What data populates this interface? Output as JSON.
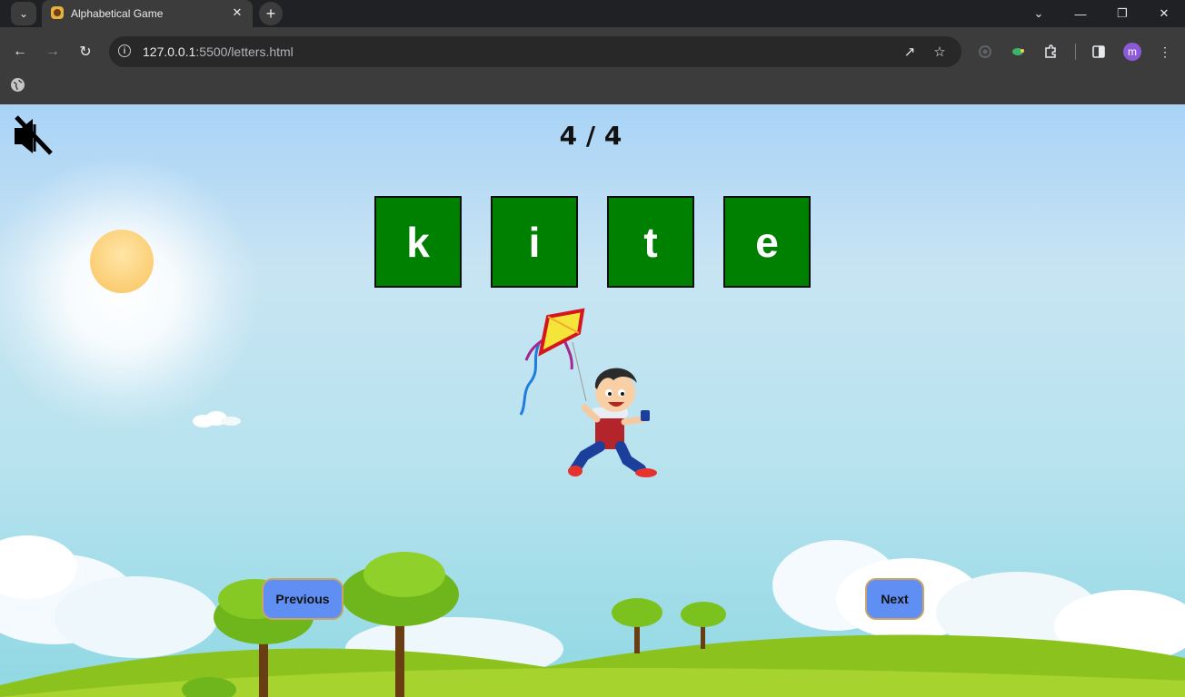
{
  "browser": {
    "tab_title": "Alphabetical Game",
    "url_host": "127.0.0.1",
    "url_rest": ":5500/letters.html",
    "avatar_letter": "m",
    "icons": [
      "tab-search-icon",
      "close-icon",
      "plus-icon",
      "chevron-down-icon",
      "minimize-icon",
      "restore-icon",
      "close-window-icon",
      "back-icon",
      "forward-icon",
      "reload-icon",
      "info-icon",
      "share-icon",
      "star-icon",
      "extensions-icon",
      "side-panel-icon",
      "more-vert-icon",
      "globe-icon"
    ]
  },
  "game": {
    "counter": "4 / 4",
    "letters": [
      "k",
      "i",
      "t",
      "e"
    ],
    "tile_color": "#008000",
    "sound_muted": true,
    "picture": "boy flying a kite",
    "buttons": {
      "previous": "Previous",
      "next": "Next"
    },
    "button_color": "#5f8ff2"
  }
}
